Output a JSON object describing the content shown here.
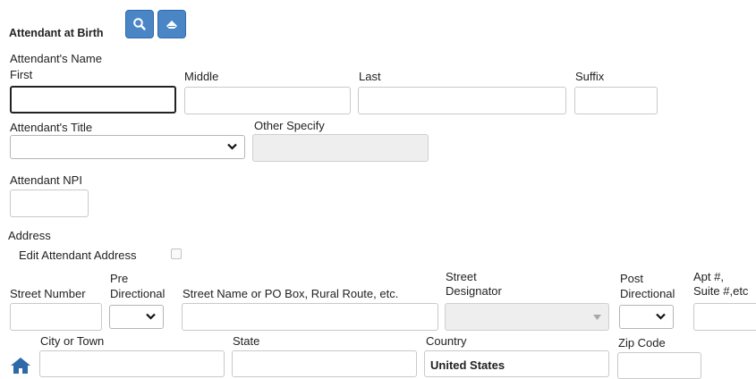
{
  "section": {
    "title": "Attendant at Birth"
  },
  "toolbar": {
    "search_icon": "search-icon",
    "clear_icon": "eraser-icon"
  },
  "name": {
    "heading": "Attendant's Name",
    "first_label": "First",
    "middle_label": "Middle",
    "last_label": "Last",
    "suffix_label": "Suffix",
    "first_value": "",
    "middle_value": "",
    "last_value": "",
    "suffix_value": ""
  },
  "title_field": {
    "label": "Attendant's Title",
    "selected": ""
  },
  "other_specify": {
    "label": "Other Specify",
    "value": ""
  },
  "npi": {
    "label": "Attendant NPI",
    "value": ""
  },
  "address": {
    "heading": "Address",
    "edit_label": "Edit Attendant Address",
    "edit_checked": false,
    "street_number_label": "Street Number",
    "pre_directional_label_1": "Pre",
    "pre_directional_label_2": "Directional",
    "street_name_label": "Street Name or PO Box, Rural Route, etc.",
    "street_designator_label_1": "Street",
    "street_designator_label_2": "Designator",
    "post_directional_label_1": "Post",
    "post_directional_label_2": "Directional",
    "apt_label_1": "Apt #,",
    "apt_label_2": "Suite #,etc",
    "city_label": "City or Town",
    "state_label": "State",
    "country_label": "Country",
    "country_value": "United States",
    "zip_label": "Zip Code",
    "home_icon": "home-icon"
  },
  "colors": {
    "button_blue": "#4a86c5",
    "home_icon": "#2f6aa8"
  }
}
